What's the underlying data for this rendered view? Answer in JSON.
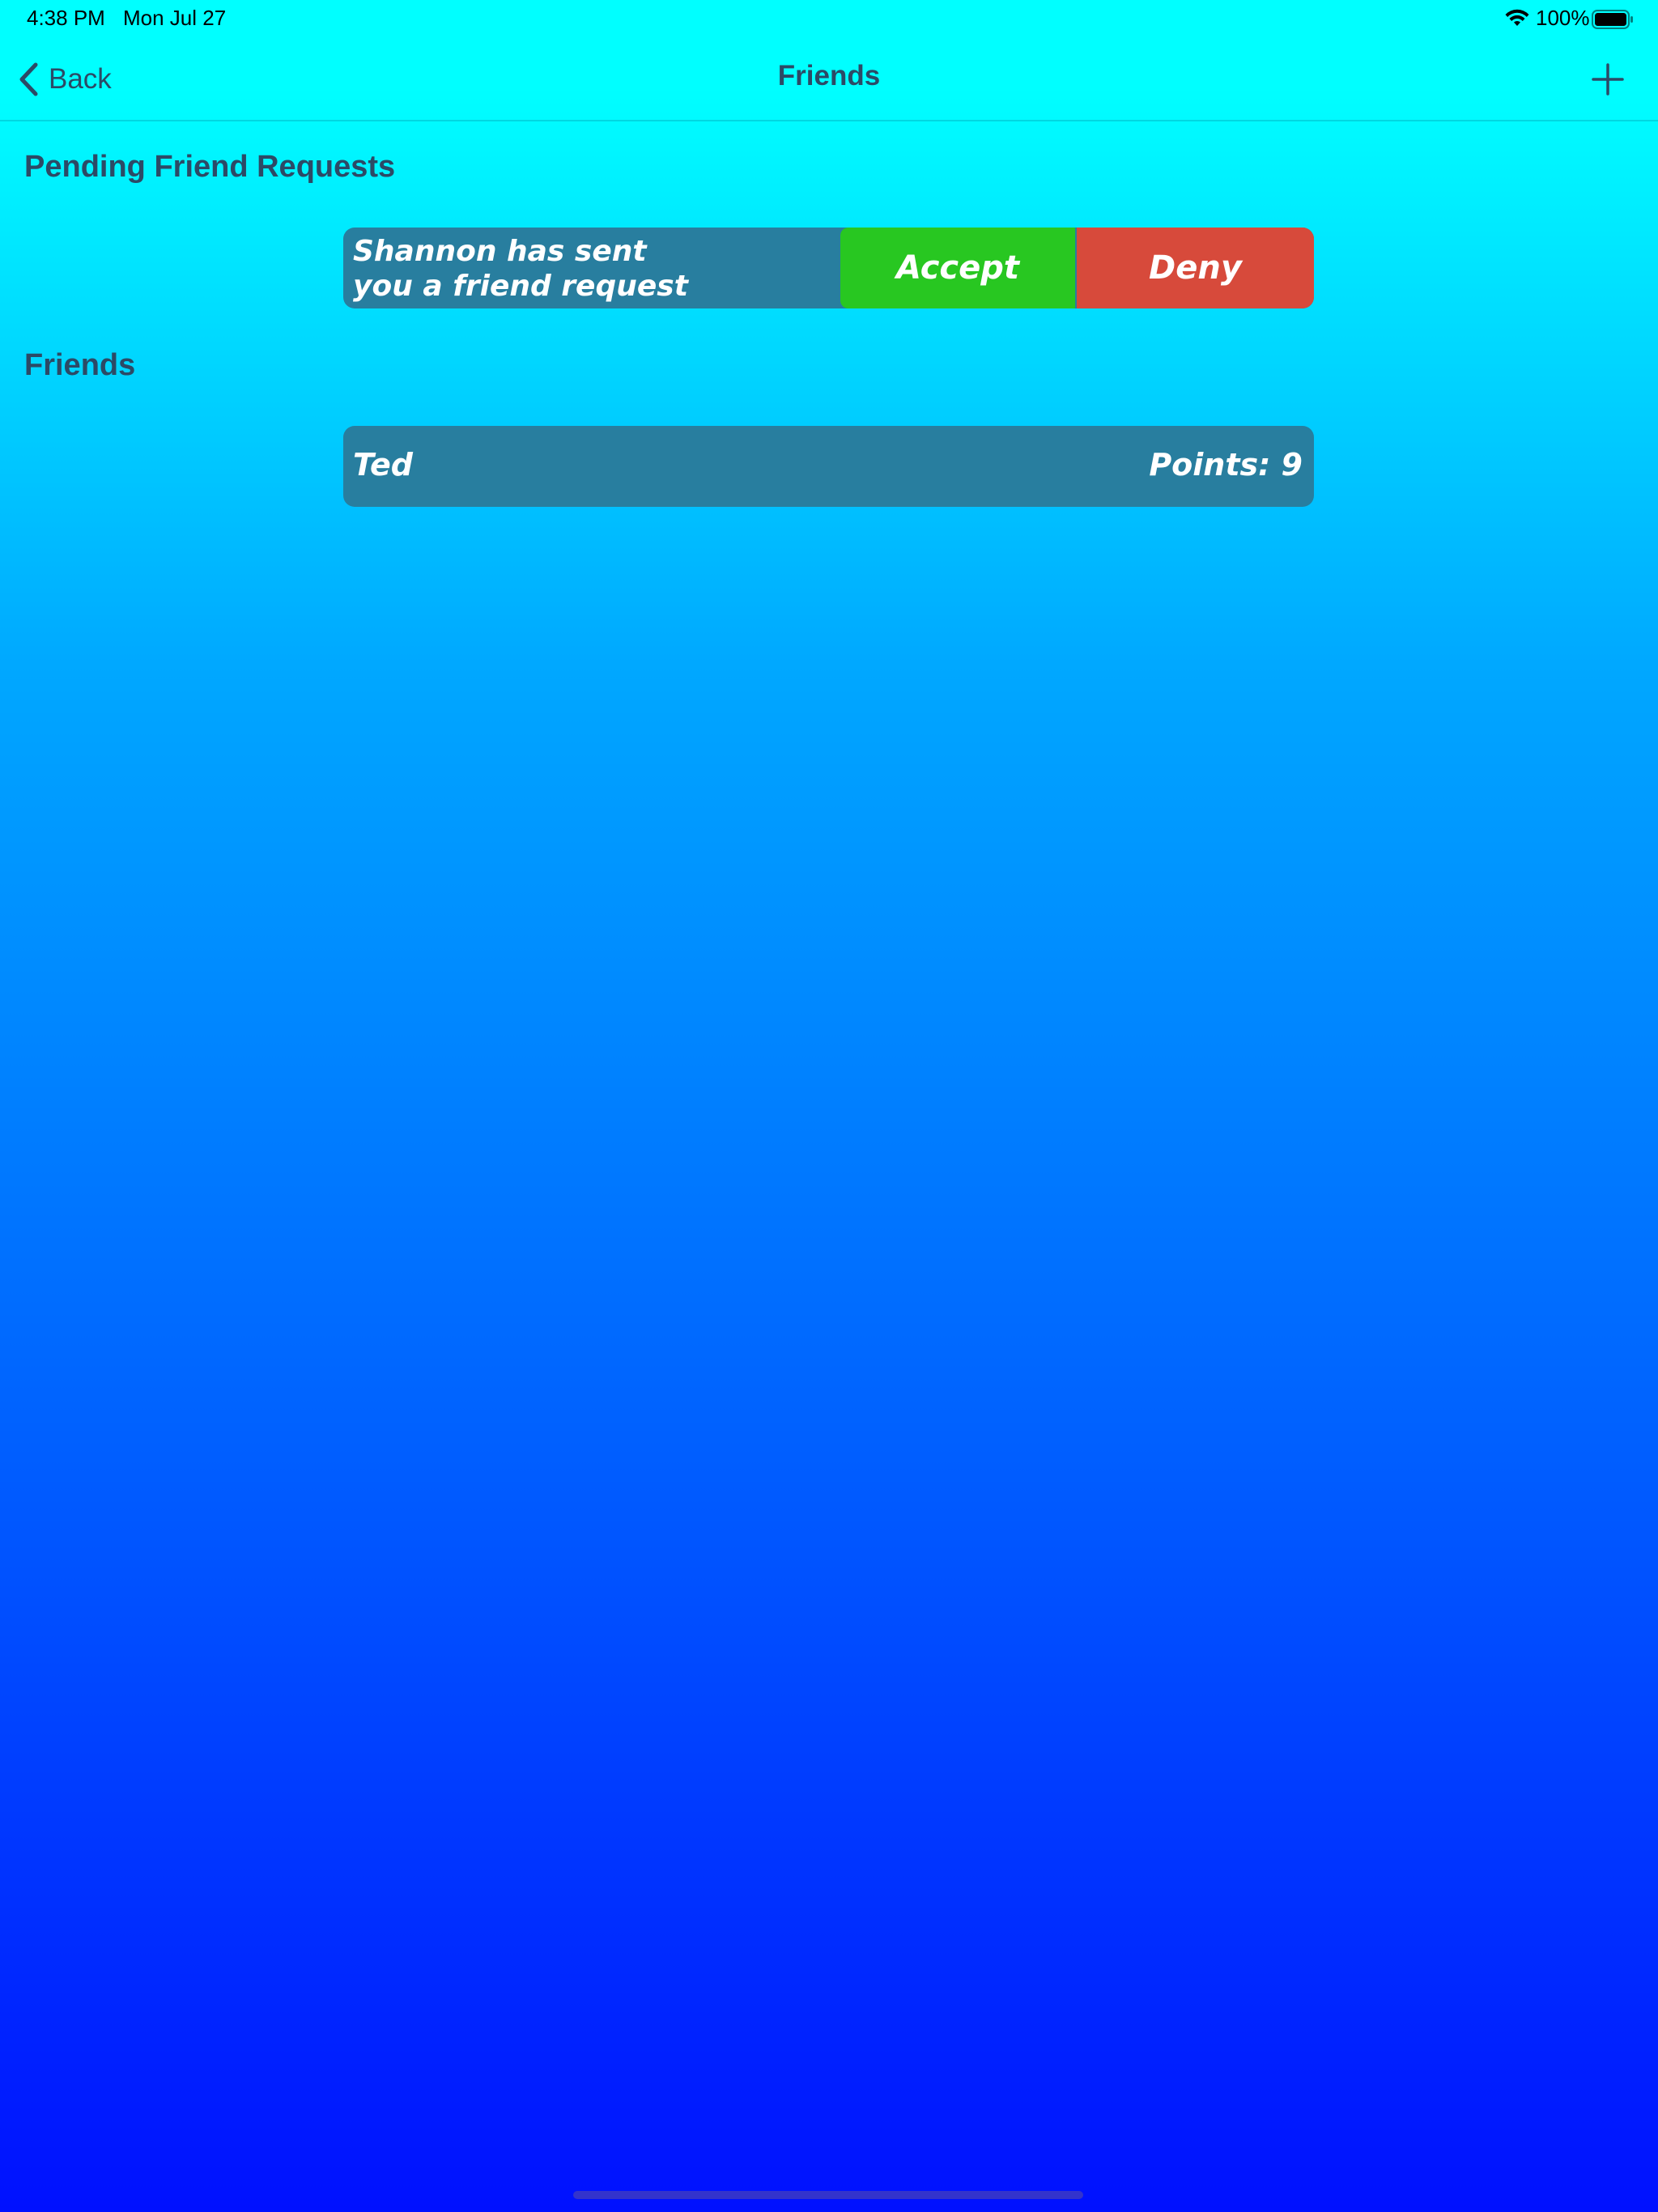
{
  "status_bar": {
    "time": "4:38 PM",
    "date": "Mon Jul 27",
    "battery_percent": "100%",
    "wifi_icon": "wifi-icon",
    "battery_icon": "battery-full-icon",
    "battery_level": 1.0
  },
  "nav": {
    "back_label": "Back",
    "back_icon": "chevron-left-icon",
    "title": "Friends",
    "add_icon": "plus-icon"
  },
  "pending": {
    "header": "Pending Friend Requests",
    "requests": [
      {
        "message": "Shannon has sent you a friend request",
        "accept_label": "Accept",
        "deny_label": "Deny"
      }
    ]
  },
  "friends": {
    "header": "Friends",
    "list": [
      {
        "name": "Ted",
        "points": "Points: 9"
      }
    ]
  },
  "colors": {
    "background_top": "#00ffff",
    "background_bottom": "#0010ff",
    "card": "#287e9f",
    "accept": "#28c721",
    "deny": "#d74a3b",
    "header_text": "#2c4a66"
  }
}
